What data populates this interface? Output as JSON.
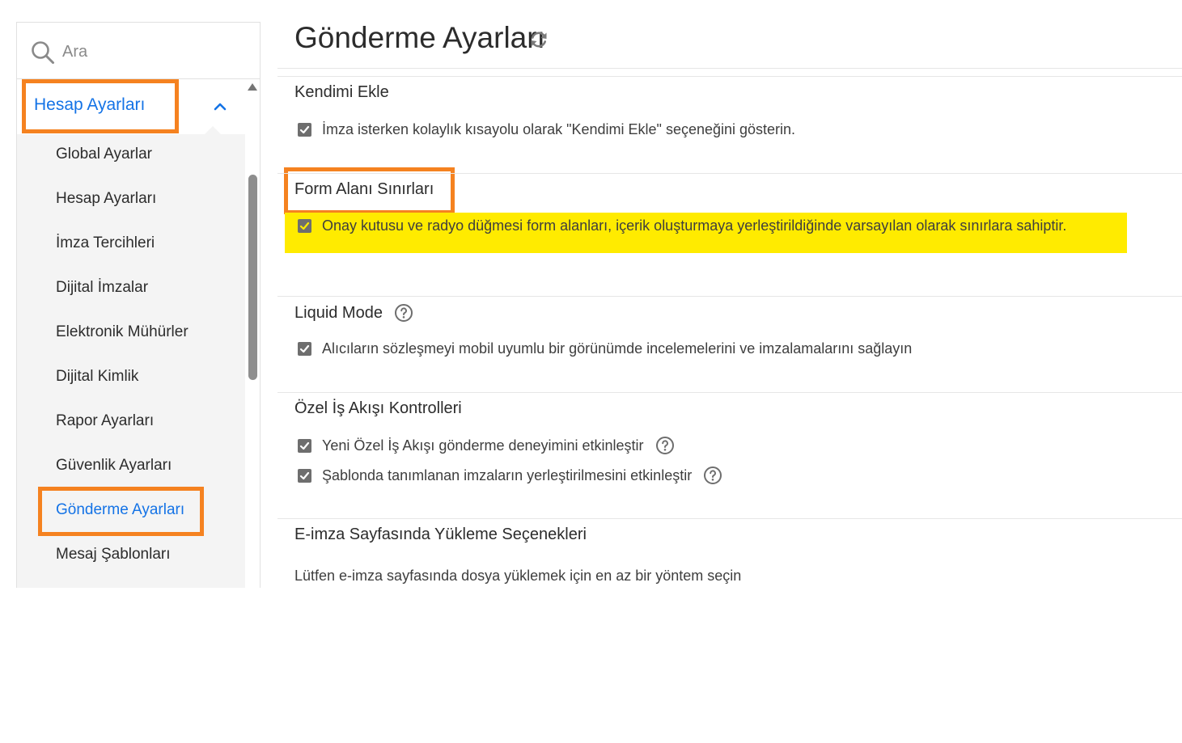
{
  "search": {
    "placeholder": "Ara"
  },
  "sidebar": {
    "group_label": "Hesap Ayarları",
    "items": [
      {
        "label": "Global Ayarlar"
      },
      {
        "label": "Hesap Ayarları"
      },
      {
        "label": "İmza Tercihleri"
      },
      {
        "label": "Dijital İmzalar"
      },
      {
        "label": "Elektronik Mühürler"
      },
      {
        "label": "Dijital Kimlik"
      },
      {
        "label": "Rapor Ayarları"
      },
      {
        "label": "Güvenlik Ayarları"
      },
      {
        "label": "Gönderme Ayarları",
        "active": true
      },
      {
        "label": "Mesaj Şablonları"
      }
    ]
  },
  "colors": {
    "accent": "#1473e6",
    "callout": "#f58220",
    "highlight": "#ffeb00"
  },
  "main": {
    "title": "Gönderme Ayarları",
    "sections": {
      "kendimi_ekle": {
        "title": "Kendimi Ekle",
        "option": "İmza isterken kolaylık kısayolu olarak \"Kendimi Ekle\" seçeneğini gösterin."
      },
      "form_alani": {
        "title": "Form Alanı Sınırları",
        "option": "Onay kutusu ve radyo düğmesi form alanları, içerik oluşturmaya yerleştirildiğinde varsayılan olarak sınırlara sahiptir."
      },
      "liquid_mode": {
        "title": "Liquid Mode",
        "option": "Alıcıların sözleşmeyi mobil uyumlu bir görünümde incelemelerini ve imzalamalarını sağlayın"
      },
      "ozel_is_akisi": {
        "title": "Özel İş Akışı Kontrolleri",
        "option1": "Yeni Özel İş Akışı gönderme deneyimini etkinleştir",
        "option2": "Şablonda tanımlanan imzaların yerleştirilmesini etkinleştir"
      },
      "e_imza": {
        "title": "E-imza Sayfasında Yükleme Seçenekleri",
        "description": "Lütfen e-imza sayfasında dosya yüklemek için en az bir yöntem seçin"
      }
    }
  }
}
